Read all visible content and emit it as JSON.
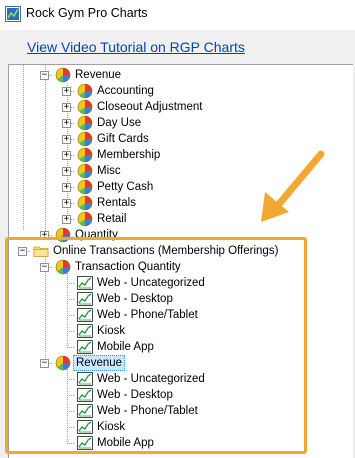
{
  "window": {
    "title": "Rock Gym Pro Charts",
    "app_icon": "chart-app-icon"
  },
  "tutorial_link": "View Video Tutorial on RGP Charts",
  "tree": {
    "revenue": {
      "label": "Revenue",
      "children": [
        "Accounting",
        "Closeout Adjustment",
        "Day Use",
        "Gift Cards",
        "Membership",
        "Misc",
        "Petty Cash",
        "Rentals",
        "Retail"
      ]
    },
    "quantity_partial": "Quantity",
    "online": {
      "label": "Online Transactions (Membership Offerings)",
      "transaction_quantity": {
        "label": "Transaction Quantity",
        "children": [
          "Web - Uncategorized",
          "Web - Desktop",
          "Web - Phone/Tablet",
          "Kiosk",
          "Mobile App"
        ]
      },
      "revenue": {
        "label": "Revenue",
        "children": [
          "Web - Uncategorized",
          "Web - Desktop",
          "Web - Phone/Tablet",
          "Kiosk",
          "Mobile App"
        ]
      }
    }
  },
  "colors": {
    "highlight_border": "#f0a830",
    "arrow": "#f0a830",
    "link": "#0645ad",
    "selected_bg": "#cce8ff"
  },
  "icons": {
    "pie": "pie-chart-icon",
    "folder": "folder-icon",
    "line_chart": "line-chart-icon"
  }
}
